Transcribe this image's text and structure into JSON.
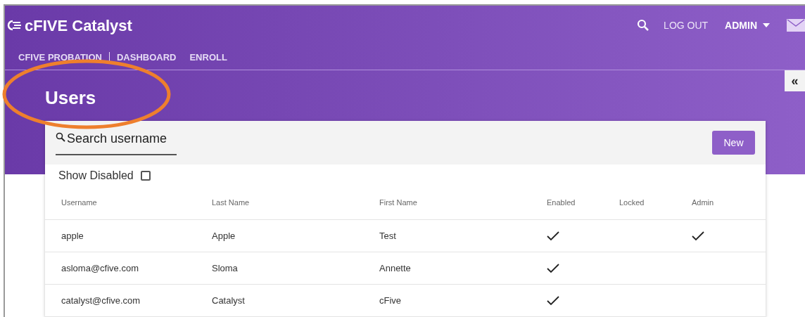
{
  "header": {
    "brand": "cFIVE Catalyst",
    "actions": {
      "logout": "LOG OUT",
      "user": "ADMIN"
    }
  },
  "nav": [
    "CFIVE PROBATION",
    "DASHBOARD",
    "ENROLL"
  ],
  "page_title": "Users",
  "search": {
    "placeholder": "Search username"
  },
  "new_button": "New",
  "show_disabled": {
    "label": "Show Disabled",
    "checked": false
  },
  "table": {
    "columns": [
      "Username",
      "Last Name",
      "First Name",
      "Enabled",
      "Locked",
      "Admin"
    ],
    "rows": [
      {
        "username": "apple",
        "last_name": "Apple",
        "first_name": "Test",
        "enabled": true,
        "locked": false,
        "admin": true
      },
      {
        "username": "asloma@cfive.com",
        "last_name": "Sloma",
        "first_name": "Annette",
        "enabled": true,
        "locked": false,
        "admin": false
      },
      {
        "username": "catalyst@cfive.com",
        "last_name": "Catalyst",
        "first_name": "cFive",
        "enabled": true,
        "locked": false,
        "admin": false
      }
    ]
  },
  "collapse_tab": "«"
}
